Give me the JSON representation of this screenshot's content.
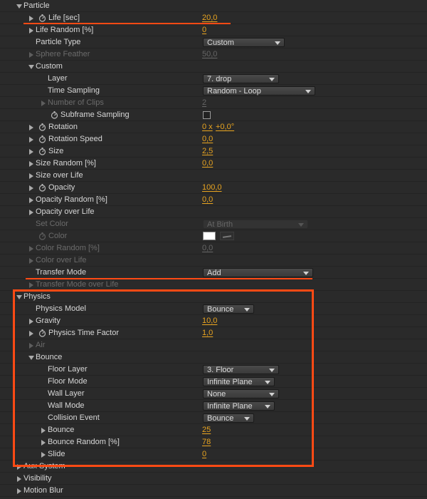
{
  "accent": "#e8a420",
  "annotation_color": "#ff4a14",
  "particle": {
    "header": "Particle",
    "life": {
      "label": "Life [sec]",
      "value": "20,0"
    },
    "life_random": {
      "label": "Life Random [%]",
      "value": "0"
    },
    "particle_type": {
      "label": "Particle Type",
      "value": "Custom"
    },
    "sphere_feather": {
      "label": "Sphere Feather",
      "value": "50,0"
    },
    "custom": {
      "label": "Custom",
      "layer": {
        "label": "Layer",
        "value": "7. drop"
      },
      "time_sampling": {
        "label": "Time Sampling",
        "value": "Random - Loop"
      },
      "number_of_clips": {
        "label": "Number of Clips",
        "value": "2"
      },
      "subframe_sampling": {
        "label": "Subframe Sampling",
        "checked": false
      }
    },
    "rotation": {
      "label": "Rotation",
      "value_turns": "0 x",
      "value_deg": "+0,0°"
    },
    "rotation_speed": {
      "label": "Rotation Speed",
      "value": "0,0"
    },
    "size": {
      "label": "Size",
      "value": "2,5"
    },
    "size_random": {
      "label": "Size Random [%]",
      "value": "0,0"
    },
    "size_over_life": {
      "label": "Size over Life"
    },
    "opacity": {
      "label": "Opacity",
      "value": "100,0"
    },
    "opacity_random": {
      "label": "Opacity Random [%]",
      "value": "0,0"
    },
    "opacity_over_life": {
      "label": "Opacity over Life"
    },
    "set_color": {
      "label": "Set Color",
      "value": "At Birth"
    },
    "color": {
      "label": "Color",
      "swatch": "#ffffff"
    },
    "color_random": {
      "label": "Color Random [%]",
      "value": "0,0"
    },
    "color_over_life": {
      "label": "Color over Life"
    },
    "transfer_mode": {
      "label": "Transfer Mode",
      "value": "Add"
    },
    "transfer_mode_over_life": {
      "label": "Transfer Mode over Life"
    }
  },
  "physics": {
    "header": "Physics",
    "physics_model": {
      "label": "Physics Model",
      "value": "Bounce"
    },
    "gravity": {
      "label": "Gravity",
      "value": "10,0"
    },
    "physics_time_factor": {
      "label": "Physics Time Factor",
      "value": "1,0"
    },
    "air": {
      "label": "Air"
    },
    "bounce_group": {
      "label": "Bounce",
      "floor_layer": {
        "label": "Floor Layer",
        "value": "3. Floor"
      },
      "floor_mode": {
        "label": "Floor Mode",
        "value": "Infinite Plane"
      },
      "wall_layer": {
        "label": "Wall Layer",
        "value": "None"
      },
      "wall_mode": {
        "label": "Wall Mode",
        "value": "Infinite Plane"
      },
      "collision_event": {
        "label": "Collision Event",
        "value": "Bounce"
      },
      "bounce": {
        "label": "Bounce",
        "value": "25"
      },
      "bounce_random": {
        "label": "Bounce Random [%]",
        "value": "78"
      },
      "slide": {
        "label": "Slide",
        "value": "0"
      }
    }
  },
  "aux_system": {
    "label": "Aux System"
  },
  "visibility": {
    "label": "Visibility"
  },
  "motion_blur": {
    "label": "Motion Blur"
  }
}
